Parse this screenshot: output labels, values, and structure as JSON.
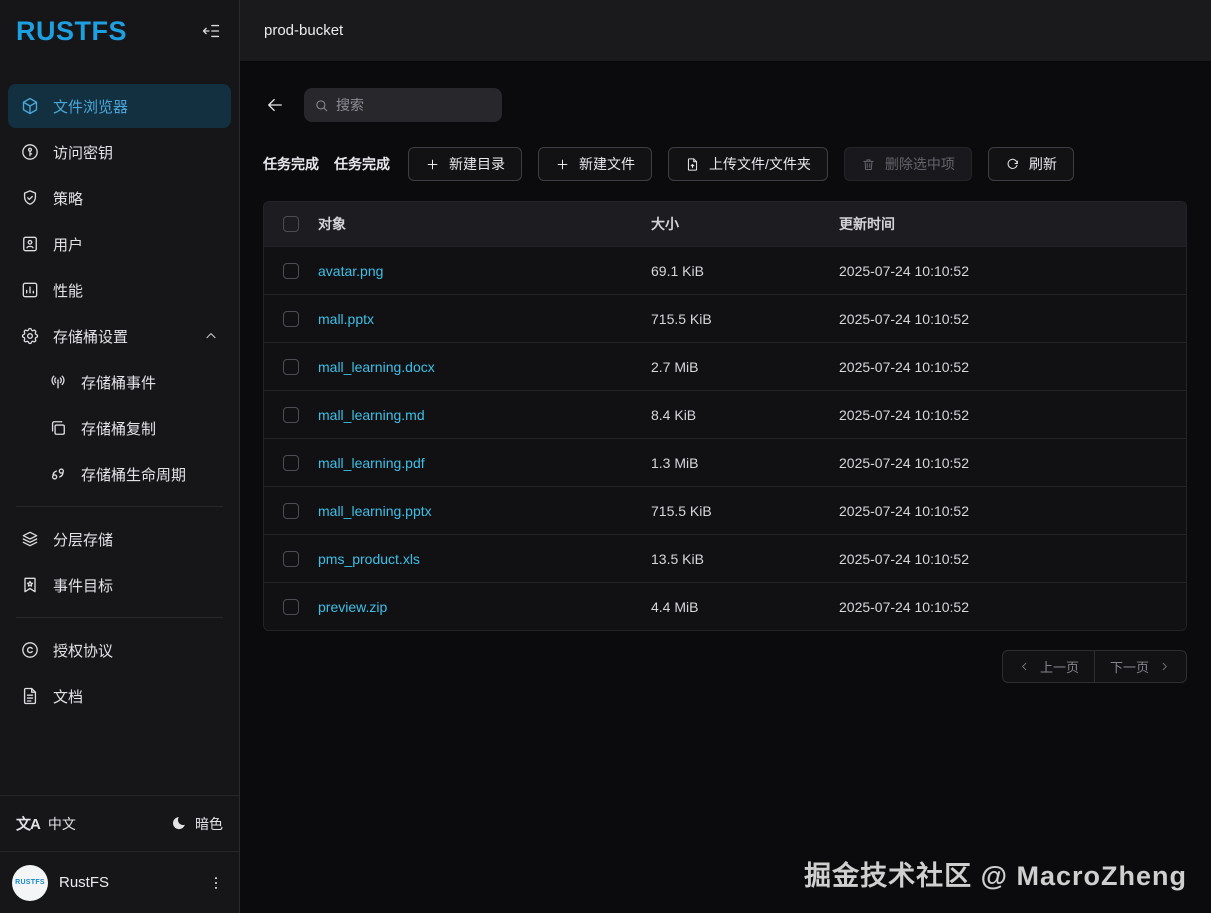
{
  "colors": {
    "accent": "#1e9fe0",
    "link": "#3ec0e6",
    "active_bg": "#12303f"
  },
  "sidebar": {
    "logo": "RUSTFS",
    "nav": [
      {
        "type": "item",
        "icon": "cube",
        "label": "文件浏览器",
        "active": true
      },
      {
        "type": "item",
        "icon": "key",
        "label": "访问密钥"
      },
      {
        "type": "item",
        "icon": "shield-check",
        "label": "策略"
      },
      {
        "type": "item",
        "icon": "user-card",
        "label": "用户"
      },
      {
        "type": "item",
        "icon": "bar-chart",
        "label": "性能"
      },
      {
        "type": "item",
        "icon": "gear",
        "label": "存储桶设置",
        "chevron": "up"
      },
      {
        "type": "item",
        "icon": "broadcast",
        "label": "存储桶事件",
        "indent": true
      },
      {
        "type": "item",
        "icon": "copy",
        "label": "存储桶复制",
        "indent": true
      },
      {
        "type": "item",
        "icon": "lifecycle",
        "label": "存储桶生命周期",
        "indent": true
      },
      {
        "type": "divider"
      },
      {
        "type": "item",
        "icon": "layers",
        "label": "分层存储"
      },
      {
        "type": "item",
        "icon": "bookmark-star",
        "label": "事件目标"
      },
      {
        "type": "divider"
      },
      {
        "type": "item",
        "icon": "copyright",
        "label": "授权协议"
      },
      {
        "type": "item",
        "icon": "file-text",
        "label": "文档"
      }
    ],
    "footer": {
      "language": "中文",
      "theme": "暗色",
      "account": "RustFS",
      "avatar_text": "RUSTFS"
    }
  },
  "header": {
    "title": "prod-bucket"
  },
  "browser": {
    "search_placeholder": "搜索",
    "task_labels": [
      "任务完成",
      "任务完成"
    ],
    "buttons": [
      {
        "icon": "plus",
        "label": "新建目录"
      },
      {
        "icon": "plus",
        "label": "新建文件"
      },
      {
        "icon": "file-upload",
        "label": "上传文件/文件夹"
      },
      {
        "icon": "trash",
        "label": "删除选中项",
        "disabled": true
      },
      {
        "icon": "refresh",
        "label": "刷新"
      }
    ],
    "table": {
      "columns": [
        "对象",
        "大小",
        "更新时间"
      ],
      "rows": [
        {
          "name": "avatar.png",
          "size": "69.1 KiB",
          "updated": "2025-07-24 10:10:52"
        },
        {
          "name": "mall.pptx",
          "size": "715.5 KiB",
          "updated": "2025-07-24 10:10:52"
        },
        {
          "name": "mall_learning.docx",
          "size": "2.7 MiB",
          "updated": "2025-07-24 10:10:52"
        },
        {
          "name": "mall_learning.md",
          "size": "8.4 KiB",
          "updated": "2025-07-24 10:10:52"
        },
        {
          "name": "mall_learning.pdf",
          "size": "1.3 MiB",
          "updated": "2025-07-24 10:10:52"
        },
        {
          "name": "mall_learning.pptx",
          "size": "715.5 KiB",
          "updated": "2025-07-24 10:10:52"
        },
        {
          "name": "pms_product.xls",
          "size": "13.5 KiB",
          "updated": "2025-07-24 10:10:52"
        },
        {
          "name": "preview.zip",
          "size": "4.4 MiB",
          "updated": "2025-07-24 10:10:52"
        }
      ]
    },
    "pagination": {
      "prev": "上一页",
      "next": "下一页"
    }
  },
  "watermark": "掘金技术社区 @ MacroZheng"
}
